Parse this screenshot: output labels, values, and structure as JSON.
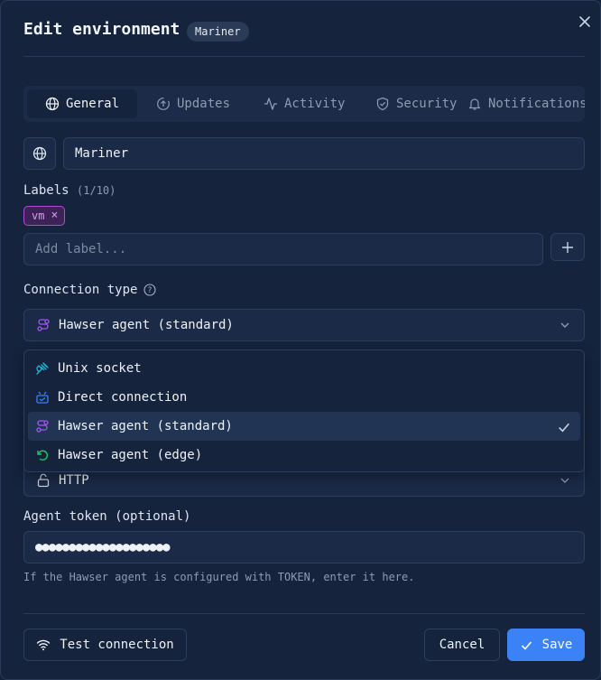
{
  "dialog": {
    "title": "Edit environment",
    "badge": "Mariner",
    "close_icon": "close-icon"
  },
  "tabs": [
    {
      "label": "General",
      "icon": "globe-icon",
      "active": true
    },
    {
      "label": "Updates",
      "icon": "refresh-icon",
      "active": false
    },
    {
      "label": "Activity",
      "icon": "activity-icon",
      "active": false
    },
    {
      "label": "Security",
      "icon": "shield-icon",
      "active": false
    },
    {
      "label": "Notifications",
      "icon": "bell-icon",
      "active": false
    }
  ],
  "name_field": {
    "value": "Mariner",
    "icon": "globe-icon"
  },
  "labels": {
    "title": "Labels",
    "count": "(1/10)",
    "chips": [
      {
        "text": "vm",
        "remove": "×"
      }
    ],
    "placeholder": "Add label...",
    "add_button": "+"
  },
  "connection": {
    "title": "Connection type",
    "help_icon": "?",
    "selected": "Hawser agent (standard)",
    "options": [
      {
        "label": "Unix socket",
        "icon": "plug-icon",
        "color": "#22b8d6",
        "selected": false
      },
      {
        "label": "Direct connection",
        "icon": "network-icon",
        "color": "#3b82f6",
        "selected": false
      },
      {
        "label": "Hawser agent (standard)",
        "icon": "route-icon",
        "color": "#a855f7",
        "selected": true
      },
      {
        "label": "Hawser agent (edge)",
        "icon": "undo-icon",
        "color": "#22c55e",
        "selected": false
      }
    ]
  },
  "protocol": {
    "value": "HTTP",
    "icon": "unlock-icon"
  },
  "token": {
    "label": "Agent token (optional)",
    "value": "●●●●●●●●●●●●●●●●●●●●",
    "help": "If the Hawser agent is configured with TOKEN, enter it here."
  },
  "footer": {
    "test_label": "Test connection",
    "cancel_label": "Cancel",
    "save_label": "Save"
  },
  "colors": {
    "accent": "#3b82f6",
    "chip_border": "#b14bd6"
  }
}
